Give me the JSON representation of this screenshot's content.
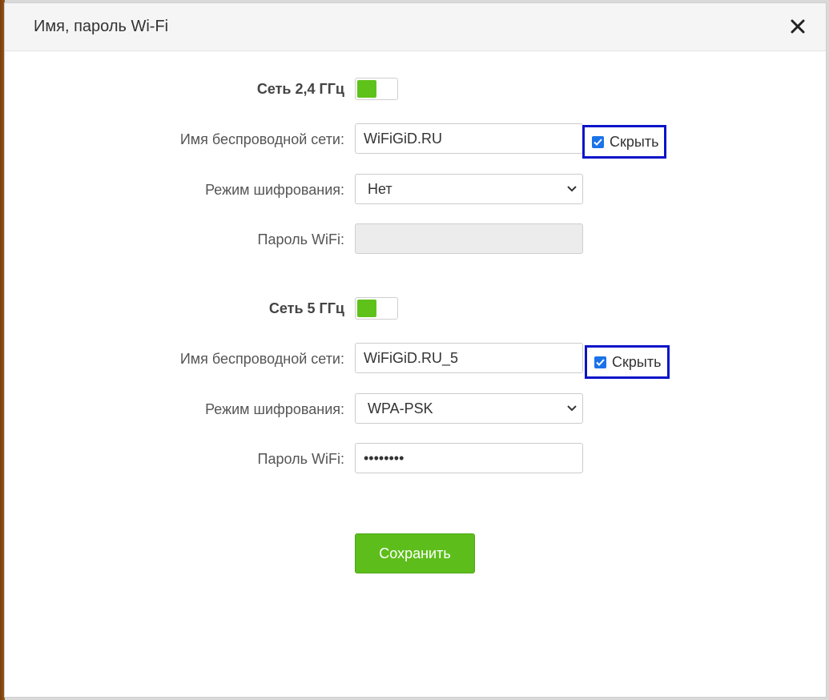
{
  "dialog": {
    "title": "Имя, пароль Wi-Fi",
    "close_icon": "close-icon"
  },
  "band_24": {
    "section_label": "Сеть 2,4 ГГц",
    "enabled": true,
    "ssid_label": "Имя беспроводной сети:",
    "ssid_value": "WiFiGiD.RU",
    "hide_label": "Скрыть",
    "hide_checked": true,
    "encryption_label": "Режим шифрования:",
    "encryption_value": "Нет",
    "password_label": "Пароль WiFi:",
    "password_value": ""
  },
  "band_5": {
    "section_label": "Сеть 5 ГГц",
    "enabled": true,
    "ssid_label": "Имя беспроводной сети:",
    "ssid_value": "WiFiGiD.RU_5",
    "hide_label": "Скрыть",
    "hide_checked": true,
    "encryption_label": "Режим шифрования:",
    "encryption_value": "WPA-PSK",
    "password_label": "Пароль WiFi:",
    "password_value": "••••••••"
  },
  "actions": {
    "save_label": "Сохранить"
  },
  "colors": {
    "accent_green": "#5dbe1b",
    "highlight_blue": "#0a14c8",
    "checkbox_blue": "#1a73e8"
  }
}
